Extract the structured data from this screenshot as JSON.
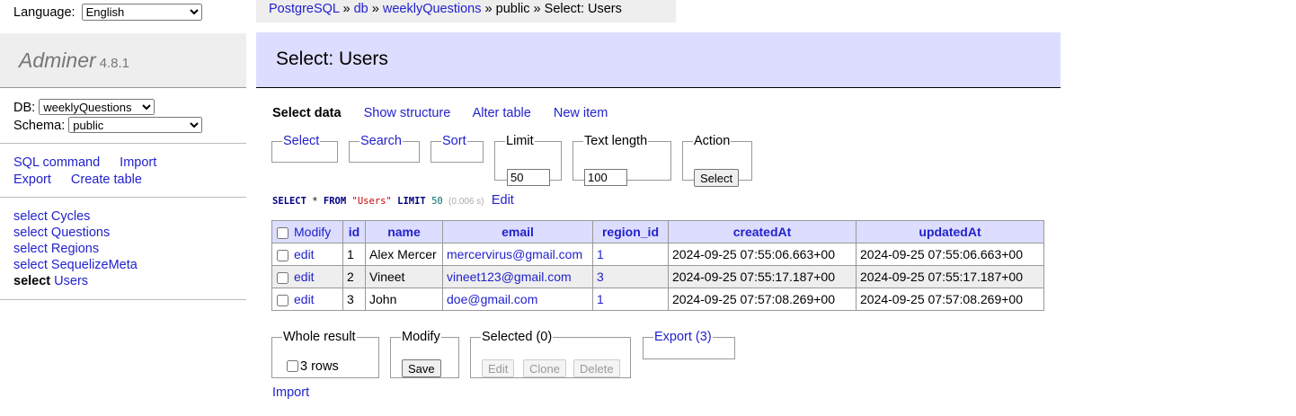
{
  "language": {
    "label": "Language:",
    "selected": "English"
  },
  "logo": {
    "name": "Adminer",
    "version": "4.8.1"
  },
  "db_select": {
    "db_label": "DB:",
    "db_value": "weeklyQuestions",
    "schema_label": "Schema:",
    "schema_value": "public"
  },
  "menu_links": {
    "sql_command": "SQL command",
    "import": "Import",
    "export": "Export",
    "create_table": "Create table"
  },
  "tables": [
    {
      "action": "select",
      "name": "Cycles"
    },
    {
      "action": "select",
      "name": "Questions"
    },
    {
      "action": "select",
      "name": "Regions"
    },
    {
      "action": "select",
      "name": "SequelizeMeta"
    },
    {
      "action": "select",
      "name": "Users"
    }
  ],
  "breadcrumb": {
    "driver": "PostgreSQL",
    "server": "db",
    "database": "weeklyQuestions",
    "schema": "public",
    "sep": "»",
    "current": "Select: Users"
  },
  "page_title": "Select: Users",
  "tabs": {
    "select_data": "Select data",
    "show_structure": "Show structure",
    "alter_table": "Alter table",
    "new_item": "New item"
  },
  "filters": {
    "select": "Select",
    "search": "Search",
    "sort": "Sort",
    "limit_label": "Limit",
    "limit_value": "50",
    "text_length_label": "Text length",
    "text_length_value": "100",
    "action_label": "Action",
    "action_button": "Select"
  },
  "query": {
    "select_kw": "SELECT",
    "star": " * ",
    "from_kw": "FROM",
    "table": "\"Users\"",
    "limit_kw": "LIMIT",
    "limit": "50",
    "time": "(0.006 s)",
    "edit": "Edit"
  },
  "table": {
    "modify_header": "Modify",
    "columns": [
      "id",
      "name",
      "email",
      "region_id",
      "createdAt",
      "updatedAt"
    ],
    "edit_label": "edit",
    "rows": [
      {
        "id": "1",
        "name": "Alex Mercer",
        "email": "mercervirus@gmail.com",
        "region_id": "1",
        "createdAt": "2024-09-25 07:55:06.663+00",
        "updatedAt": "2024-09-25 07:55:06.663+00"
      },
      {
        "id": "2",
        "name": "Vineet",
        "email": "vineet123@gmail.com",
        "region_id": "3",
        "createdAt": "2024-09-25 07:55:17.187+00",
        "updatedAt": "2024-09-25 07:55:17.187+00"
      },
      {
        "id": "3",
        "name": "John",
        "email": "doe@gmail.com",
        "region_id": "1",
        "createdAt": "2024-09-25 07:57:08.269+00",
        "updatedAt": "2024-09-25 07:57:08.269+00"
      }
    ]
  },
  "bottom": {
    "whole_result_label": "Whole result",
    "rows_count": "3 rows",
    "modify_label": "Modify",
    "save": "Save",
    "selected_label": "Selected (0)",
    "edit": "Edit",
    "clone": "Clone",
    "delete": "Delete",
    "export_label": "Export (3)",
    "import": "Import"
  },
  "colors": {
    "link": "#2222cc",
    "header_bg": "#ddf",
    "sidebar_bg": "#eee"
  }
}
